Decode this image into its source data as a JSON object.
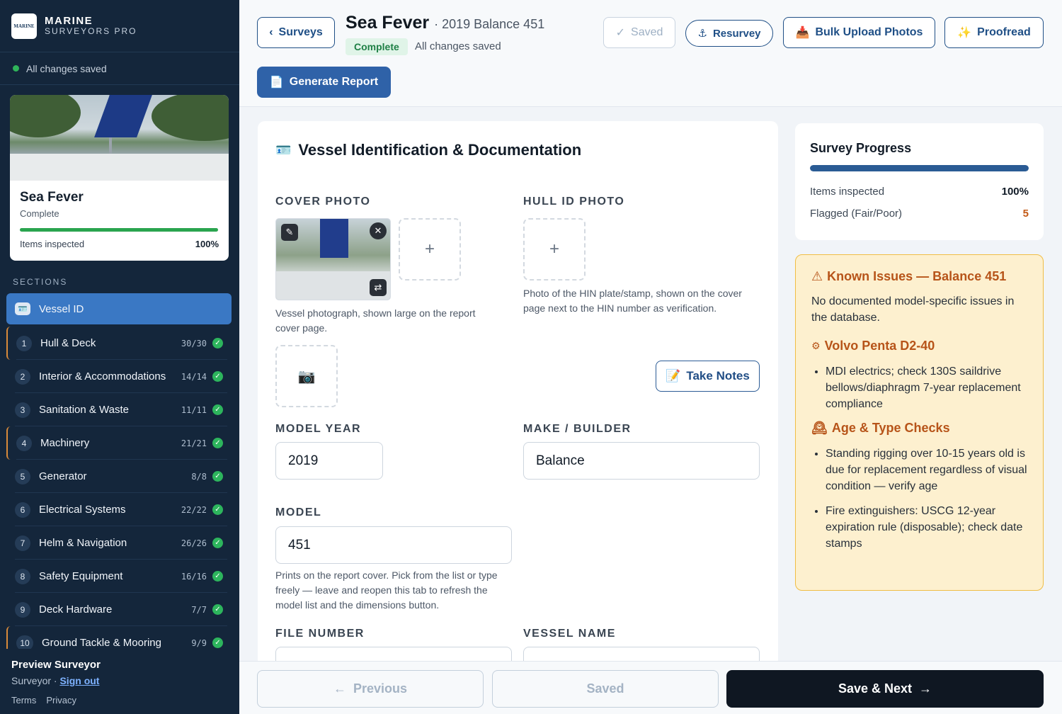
{
  "app": {
    "brand_line1": "MARINE",
    "brand_line2": "SURVEYORS PRO",
    "logo_text": "MARINE"
  },
  "sidebar": {
    "saved_status": "All changes saved",
    "vessel": {
      "name": "Sea Fever",
      "status": "Complete",
      "items_label": "Items inspected",
      "items_pct": "100%",
      "progress": 1.0
    },
    "sections_heading": "SECTIONS",
    "active": {
      "label": "Vessel ID",
      "icon": "id-card-icon"
    },
    "items": [
      {
        "num": "1",
        "label": "Hull & Deck",
        "count": "30/30",
        "accent": true
      },
      {
        "num": "2",
        "label": "Interior & Accommodations",
        "count": "14/14",
        "accent": false
      },
      {
        "num": "3",
        "label": "Sanitation & Waste",
        "count": "11/11",
        "accent": false
      },
      {
        "num": "4",
        "label": "Machinery",
        "count": "21/21",
        "accent": true
      },
      {
        "num": "5",
        "label": "Generator",
        "count": "8/8",
        "accent": false
      },
      {
        "num": "6",
        "label": "Electrical Systems",
        "count": "22/22",
        "accent": false
      },
      {
        "num": "7",
        "label": "Helm & Navigation",
        "count": "26/26",
        "accent": false
      },
      {
        "num": "8",
        "label": "Safety Equipment",
        "count": "16/16",
        "accent": false
      },
      {
        "num": "9",
        "label": "Deck Hardware",
        "count": "7/7",
        "accent": false
      },
      {
        "num": "10",
        "label": "Ground Tackle & Mooring",
        "count": "9/9",
        "accent": true
      }
    ],
    "user": {
      "name": "Preview Surveyor",
      "role": "Surveyor ·",
      "signout": "Sign out",
      "terms": "Terms",
      "privacy": "Privacy"
    }
  },
  "header": {
    "back_label": "Surveys",
    "title": "Sea Fever",
    "subtitle": "· 2019 Balance 451",
    "status_pill": "Complete",
    "autosave": "All changes saved",
    "saved_label": "Saved",
    "resurvey_label": "Resurvey",
    "bulk_upload_label": "Bulk Upload Photos",
    "proofread_label": "Proofread",
    "generate_label": "Generate Report"
  },
  "main": {
    "title": "Vessel Identification & Documentation",
    "cover_photo_label": "COVER PHOTO",
    "cover_photo_help": "Vessel photograph, shown large on the report cover page.",
    "hull_id_label": "HULL ID PHOTO",
    "hull_id_help": "Photo of the HIN plate/stamp, shown on the cover page next to the HIN number as verification.",
    "take_notes": "Take Notes",
    "model_year_label": "MODEL YEAR",
    "model_year": "2019",
    "make_label": "MAKE / BUILDER",
    "make": "Balance",
    "model_label": "MODEL",
    "model": "451",
    "model_help": "Prints on the report cover. Pick from the list or type freely — leave and reopen this tab to refresh the model list and the dimensions button.",
    "file_number_label": "FILE NUMBER",
    "vessel_name_label": "VESSEL NAME"
  },
  "progress": {
    "title": "Survey Progress",
    "fraction": 1.0,
    "items_label": "Items inspected",
    "items_value": "100%",
    "flagged_label": "Flagged (Fair/Poor)",
    "flagged_value": "5"
  },
  "issues": {
    "title": "Known Issues — Balance 451",
    "text": "No documented model-specific issues in the database.",
    "engine_title": "Volvo Penta D2-40",
    "engine_items": [
      "MDI electrics; check 130S saildrive bellows/diaphragm 7-year replacement compliance"
    ],
    "age_title": "Age & Type Checks",
    "age_items": [
      "Standing rigging over 10-15 years old is due for replacement regardless of visual condition — verify age",
      "Fire extinguishers: USCG 12-year expiration rule (disposable); check date stamps"
    ]
  },
  "footer": {
    "previous": "Previous",
    "saved": "Saved",
    "next": "Save & Next"
  },
  "colors": {
    "sidebar_bg": "#14263b",
    "accent_blue": "#2f62a8",
    "active_nav": "#3a78c4",
    "success": "#2db55d",
    "warning_bg": "#fdf0cf",
    "warning_text": "#b75419"
  }
}
